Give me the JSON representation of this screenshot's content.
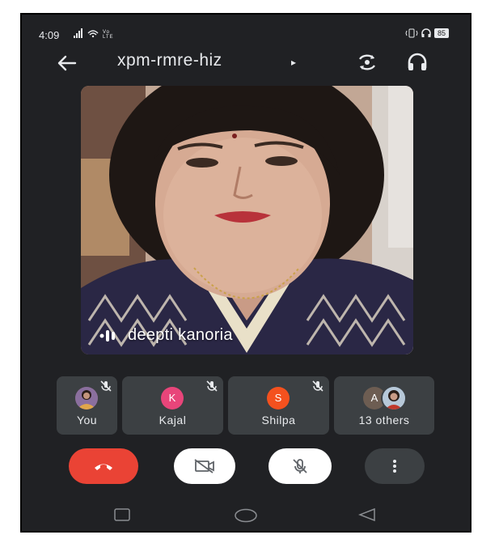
{
  "status_bar": {
    "time": "4:09",
    "left_icons": [
      "signal-icon",
      "wifi-icon",
      "volte-icon"
    ],
    "right_icons": [
      "vibrate-icon",
      "headphones-status-icon"
    ],
    "battery": "85"
  },
  "header": {
    "meeting_code": "xpm-rmre-hiz",
    "caret": "▸",
    "icons": [
      "back-arrow-icon",
      "switch-camera-icon",
      "headphones-icon"
    ]
  },
  "main_video": {
    "speaker_name": "deepti kanoria",
    "speaking_indicator": "speaking-icon"
  },
  "participants": [
    {
      "name": "You",
      "initial": "",
      "avatar_type": "photo",
      "muted": true
    },
    {
      "name": "Kajal",
      "initial": "K",
      "avatar_color": "#e8457a",
      "muted": true
    },
    {
      "name": "Shilpa",
      "initial": "S",
      "avatar_color": "#f4511e",
      "muted": true
    },
    {
      "name": "13 others",
      "initial": "A",
      "avatar_color": "#6d5d52",
      "muted": false
    }
  ],
  "controls": [
    {
      "name": "end-call",
      "icon": "phone-hangup-icon",
      "color": "#ea4335"
    },
    {
      "name": "camera-off",
      "icon": "video-off-icon",
      "color": "#ffffff"
    },
    {
      "name": "mic-off",
      "icon": "mic-off-icon",
      "color": "#ffffff"
    },
    {
      "name": "more-options",
      "icon": "more-vert-icon",
      "color": "#3c4043"
    }
  ],
  "nav_bar": [
    "recents-icon",
    "home-icon",
    "back-triangle-icon"
  ],
  "colors": {
    "background": "#202124",
    "tile": "#3c4043",
    "text": "#e8eaed",
    "end_call": "#ea4335"
  }
}
